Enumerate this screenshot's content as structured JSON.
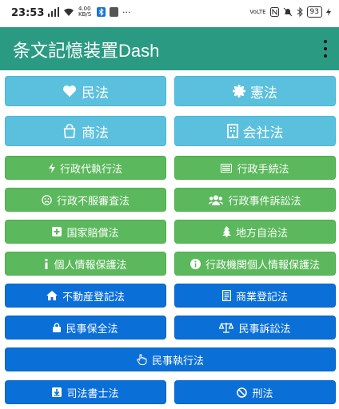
{
  "status": {
    "time": "23:53",
    "net_speed": "4.00 KB/S",
    "more": "···",
    "volte": "VoLTE",
    "battery": "93"
  },
  "app": {
    "title": "条文記憶装置Dash"
  },
  "buttons": {
    "minpo": "民法",
    "kenpo": "憲法",
    "shoho": "商法",
    "kaishaho": "会社法",
    "gyosei_daishikko": "行政代執行法",
    "gyosei_tetsuzuki": "行政手続法",
    "gyosei_fufuku": "行政不服審査法",
    "gyosei_jiken": "行政事件訴訟法",
    "kokka_baisho": "国家賠償法",
    "chiho_jichi": "地方自治法",
    "kojin_joho": "個人情報保護法",
    "gyosei_kikan_kojin": "行政機関個人情報保護法",
    "fudosan_toki": "不動産登記法",
    "shogyo_toki": "商業登記法",
    "minji_hozen": "民事保全法",
    "minji_sosho": "民事訴訟法",
    "minji_shikko": "民事執行法",
    "shiho_shoshi": "司法書士法",
    "keiho": "刑法"
  },
  "colors": {
    "appbar": "#2a9b82",
    "info": "#5bc0de",
    "success": "#5cb85c",
    "primary": "#0b6fd8"
  },
  "icons": {
    "minpo": "heart-icon",
    "kenpo": "certificate-icon",
    "shoho": "shopping-bag-icon",
    "kaishaho": "building-icon",
    "gyosei_daishikko": "bolt-icon",
    "gyosei_tetsuzuki": "list-icon",
    "gyosei_fufuku": "frown-icon",
    "gyosei_jiken": "users-icon",
    "kokka_baisho": "plus-square-icon",
    "chiho_jichi": "tree-icon",
    "kojin_joho": "info-icon",
    "gyosei_kikan_kojin": "info-circle-icon",
    "fudosan_toki": "home-icon",
    "shogyo_toki": "document-icon",
    "minji_hozen": "lock-icon",
    "minji_sosho": "balance-scale-icon",
    "minji_shikko": "hand-pointer-icon",
    "shiho_shoshi": "download-icon",
    "keiho": "ban-icon"
  }
}
